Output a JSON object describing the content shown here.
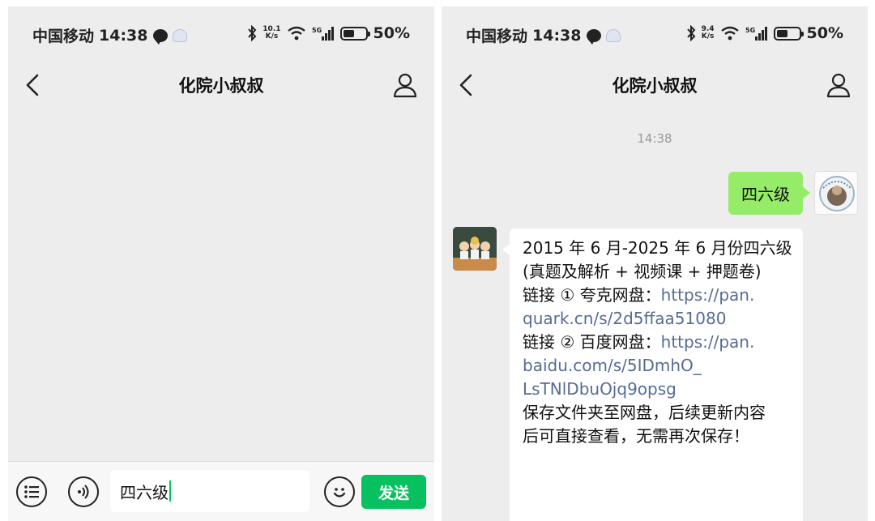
{
  "status_bar": {
    "carrier": "中国移动",
    "time": "14:38",
    "battery": "50%",
    "battery_level": 0.5,
    "net_speed_left": {
      "value": "10.1",
      "unit": "K/s"
    },
    "net_speed_right": {
      "value": "9.4",
      "unit": "K/s"
    },
    "network_type": "5G"
  },
  "chat": {
    "title": "化院小叔叔",
    "input_text": "四六级",
    "send_label": "发送",
    "timestamp": "14:38",
    "sent_message": "四六级",
    "reply": {
      "line1": "2015 年 6 月-2025 年 6 月份四六级",
      "line2": "(真题及解析 + 视频课 + 押题卷)",
      "line3_prefix": "链接 ① 夸克网盘：",
      "line3_link": "https://pan.",
      "line4_link": "quark.cn/s/2d5ffaa51080",
      "line5_prefix": "链接 ② 百度网盘：",
      "line5_link": "https://pan.",
      "line6_link": "baidu.com/s/5IDmhO_",
      "line7_link": "LsTNlDbuOjq9opsg",
      "line8": "保存文件夹至网盘，后续更新内容",
      "line9": "后可直接查看，无需再次保存！"
    }
  },
  "colors": {
    "send_green": "#07c160",
    "bubble_green": "#95ec69",
    "link_blue": "#576b95",
    "chat_bg": "#ededed"
  },
  "icons": [
    "back-arrow-icon",
    "profile-icon",
    "list-menu-icon",
    "voice-icon",
    "emoji-icon",
    "bluetooth-icon",
    "wifi-icon",
    "signal-icon",
    "battery-icon",
    "message-notification-icon",
    "ghost-app-icon"
  ]
}
